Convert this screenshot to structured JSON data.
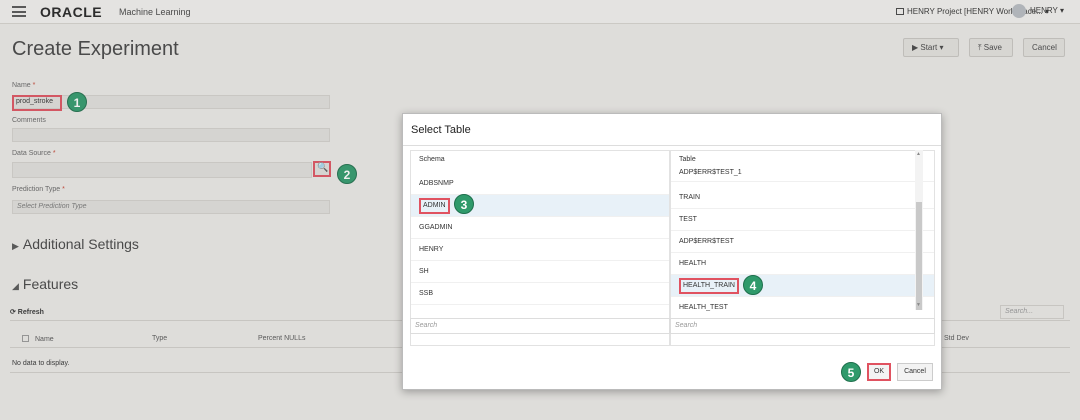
{
  "topbar": {
    "brand": "ORACLE",
    "brand_sub": "Machine Learning",
    "project_selector": "HENRY Project [HENRY Workspace... ▾",
    "user": "HENRY ▾"
  },
  "page": {
    "title": "Create Experiment",
    "start_label": "▶ Start ▾",
    "save_label": "⤒ Save",
    "cancel_label": "Cancel"
  },
  "form": {
    "name_label": "Name",
    "required_mark": "*",
    "name_value": "prod_stroke",
    "comments_label": "Comments",
    "data_source_label": "Data Source",
    "prediction_type_label": "Prediction Type",
    "prediction_type_placeholder": "Select Prediction Type",
    "search_icon": "🔍"
  },
  "sections": {
    "additional_settings": "Additional Settings",
    "features": "Features"
  },
  "features_table": {
    "refresh_label": "⟳ Refresh",
    "search_placeholder": "Search...",
    "headers": [
      "Name",
      "Type",
      "Percent NULLs",
      "Std Dev"
    ],
    "empty_message": "No data to display."
  },
  "steps": [
    "1",
    "2",
    "3",
    "4",
    "5"
  ],
  "dialog": {
    "title": "Select Table",
    "schema_header": "Schema",
    "table_header": "Table",
    "schemas": [
      "ADBSNMP",
      "ADMIN",
      "GGADMIN",
      "HENRY",
      "SH",
      "SSB"
    ],
    "selected_schema": "ADMIN",
    "tables": [
      "ADP$ERR$TEST_1",
      "TRAIN",
      "TEST",
      "ADP$ERR$TEST",
      "HEALTH",
      "HEALTH_TRAIN",
      "HEALTH_TEST"
    ],
    "selected_table": "HEALTH_TRAIN",
    "schema_search_placeholder": "Search",
    "table_search_placeholder": "Search",
    "ok_label": "OK",
    "cancel_label": "Cancel"
  },
  "colors": {
    "highlight": "#e05260",
    "step_badge": "#2f9a6b",
    "selected_row": "#e8f1f8"
  }
}
